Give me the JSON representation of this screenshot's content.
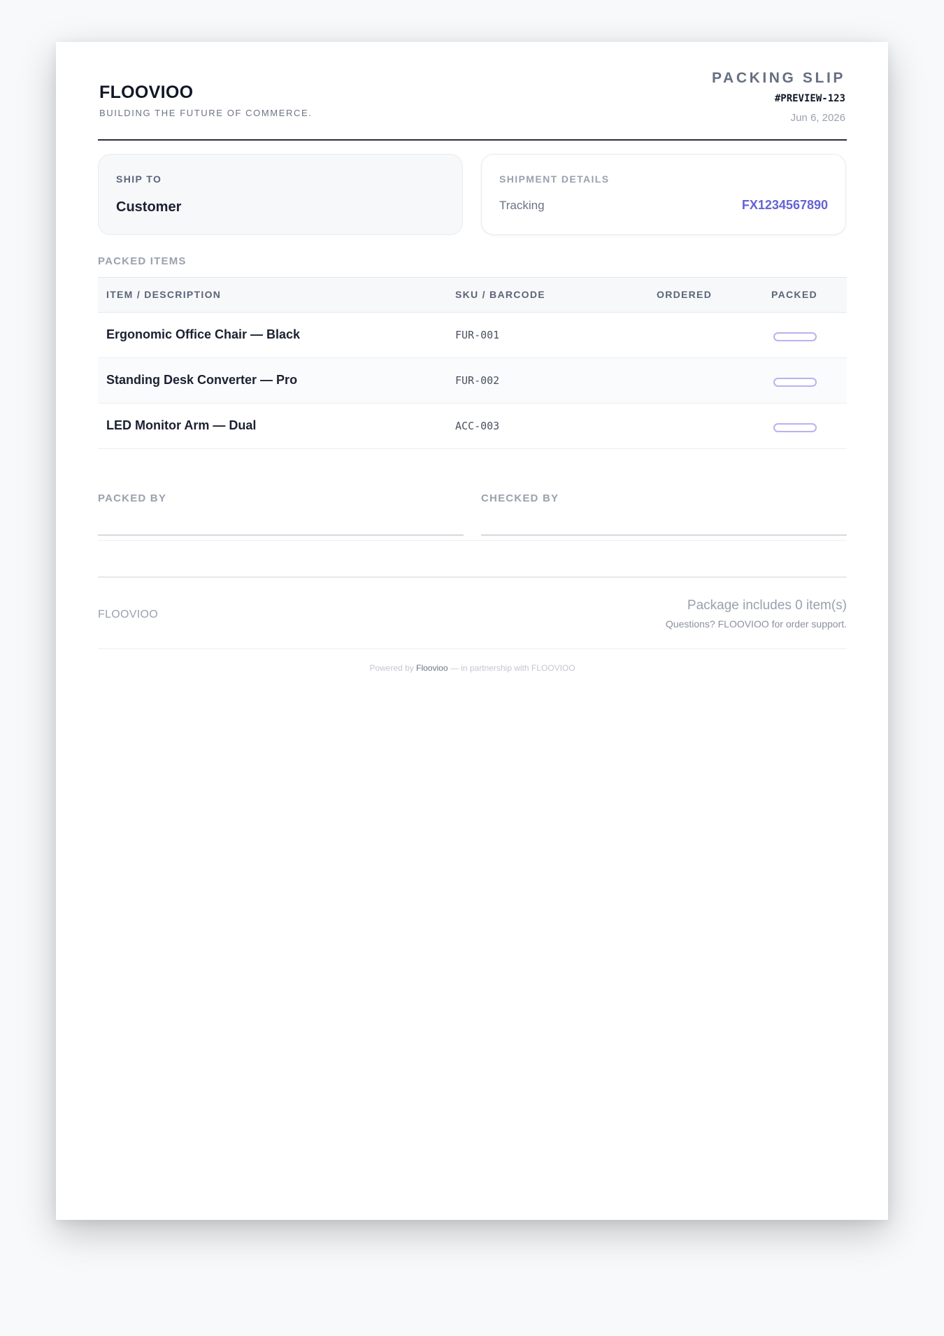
{
  "header": {
    "brand_name": "FLOOVIOO",
    "tagline": "BUILDING THE FUTURE OF COMMERCE.",
    "doc_title": "PACKING SLIP",
    "doc_number": "#PREVIEW-123",
    "date": "Jun 6, 2026"
  },
  "ship_to": {
    "label": "SHIP TO",
    "name": "Customer"
  },
  "shipment": {
    "label": "SHIPMENT DETAILS",
    "tracking_label": "Tracking",
    "tracking_number": "FX1234567890"
  },
  "items_section": {
    "label": "PACKED ITEMS",
    "columns": {
      "item": "ITEM / DESCRIPTION",
      "sku": "SKU / BARCODE",
      "ordered": "ORDERED",
      "packed": "PACKED"
    },
    "rows": [
      {
        "name": "Ergonomic Office Chair — Black",
        "sku": "FUR-001"
      },
      {
        "name": "Standing Desk Converter — Pro",
        "sku": "FUR-002"
      },
      {
        "name": "LED Monitor Arm — Dual",
        "sku": "ACC-003"
      }
    ]
  },
  "signatures": {
    "packed_by": "PACKED BY",
    "checked_by": "CHECKED BY"
  },
  "footer": {
    "brand": "FLOOVIOO",
    "package_count": "Package includes 0 item(s)",
    "support": "Questions? FLOOVIOO for order support.",
    "powered_prefix": "Powered by ",
    "powered_brand": "Floovioo",
    "powered_suffix": " — in partnership with FLOOVIOO"
  },
  "colors": {
    "accent": "#6563d4",
    "checkbox_border": "#b9b2ef",
    "page_background": "#f8f9fb"
  }
}
